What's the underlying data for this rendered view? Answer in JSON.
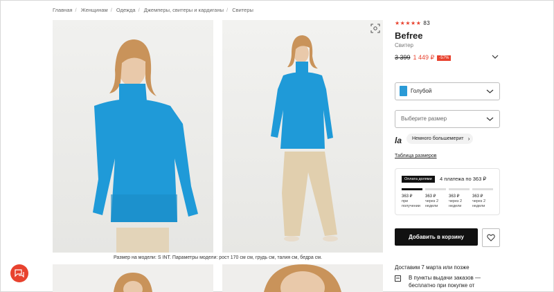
{
  "breadcrumb": [
    "Главная",
    "Женщинам",
    "Одежда",
    "Джемперы, свитеры и кардиганы",
    "Свитеры"
  ],
  "gallery": {
    "caption": "Размер на модели: S INT. Параметры модели: рост 170 см см, грудь см, талия см, бедра см."
  },
  "product": {
    "stars": "★★★★★",
    "review_count": "83",
    "brand": "Befree",
    "type": "Свитер",
    "old_price": "3 399",
    "new_price": "1 449 ₽",
    "discount": "-57%"
  },
  "color_select": {
    "value": "Голубой",
    "swatch": "#2a9ad6"
  },
  "size_select": {
    "placeholder": "Выберите размер"
  },
  "fit": {
    "logo": "la",
    "text": "Немного большемерит"
  },
  "size_table_link": "Таблица размеров",
  "split": {
    "badge": "Оплата долями",
    "text": "4 платежа по 363 ₽",
    "payments": [
      {
        "amount": "363 ₽",
        "when": "при получении"
      },
      {
        "amount": "363 ₽",
        "when": "через 2 недели"
      },
      {
        "amount": "363 ₽",
        "when": "через 2 недели"
      },
      {
        "amount": "363 ₽",
        "when": "через 2 недели"
      }
    ]
  },
  "cart_button": "Добавить в корзину",
  "delivery": {
    "date": "Доставим 7 марта или позже",
    "pickup": "В пункты выдачи заказов — бесплатно при покупке от"
  },
  "colors": {
    "accent": "#e8422e",
    "sweater": "#1f9ad8",
    "dark": "#111111"
  }
}
